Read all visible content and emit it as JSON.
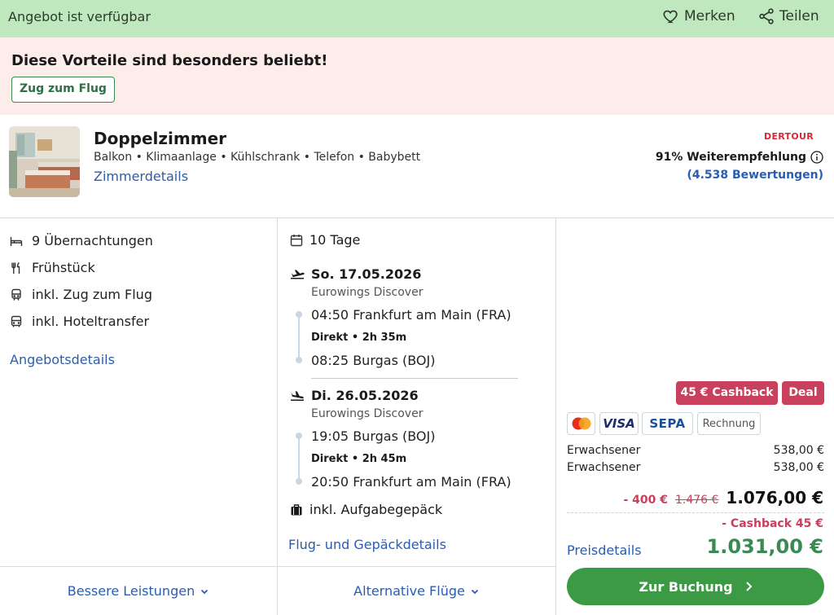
{
  "topbar": {
    "status": "Angebot ist verfügbar",
    "save_label": "Merken",
    "share_label": "Teilen",
    "bg_color": "#bfe8bf",
    "icons": [
      "heart-icon",
      "share-icon"
    ]
  },
  "promo": {
    "title": "Diese Vorteile sind besonders beliebt!",
    "chip": "Zug zum Flug",
    "bg_color": "#fcecea"
  },
  "room": {
    "name": "Doppelzimmer",
    "features": "Balkon • Klimaanlage • Kühlschrank • Telefon • Babybett",
    "details_link": "Zimmerdetails",
    "brand": "DERTOUR",
    "recommendation": "91% Weiterempfehlung",
    "reviews": "(4.538 Bewertungen)"
  },
  "inclusions": {
    "items": [
      {
        "icon": "bed-icon",
        "label": "9 Übernachtungen"
      },
      {
        "icon": "cutlery-icon",
        "label": "Frühstück"
      },
      {
        "icon": "train-icon",
        "label": "inkl. Zug zum Flug"
      },
      {
        "icon": "bus-icon",
        "label": "inkl. Hoteltransfer"
      }
    ],
    "details_link": "Angebotsdetails",
    "more_button": "Bessere Leistungen"
  },
  "flights": {
    "duration": "10 Tage",
    "outbound": {
      "date": "So. 17.05.2026",
      "airline": "Eurowings Discover",
      "dep": "04:50 Frankfurt am Main (FRA)",
      "info": "Direkt • 2h 35m",
      "arr": "08:25 Burgas (BOJ)"
    },
    "inbound": {
      "date": "Di. 26.05.2026",
      "airline": "Eurowings Discover",
      "dep": "19:05 Burgas (BOJ)",
      "info": "Direkt • 2h 45m",
      "arr": "20:50 Frankfurt am Main (FRA)"
    },
    "baggage": "inkl. Aufgabegepäck",
    "details_link": "Flug- und Gepäckdetails",
    "more_button": "Alternative Flüge"
  },
  "pricing": {
    "badges": [
      "45 € Cashback",
      "Deal"
    ],
    "payment_methods": [
      "mastercard",
      "VISA",
      "SEPA",
      "Rechnung"
    ],
    "lines": [
      {
        "label": "Erwachsener",
        "value": "538,00 €"
      },
      {
        "label": "Erwachsener",
        "value": "538,00 €"
      }
    ],
    "discount": "- 400 €",
    "old_price": "1.476 €",
    "subtotal": "1.076,00 €",
    "cashback": "- Cashback 45 €",
    "details_link": "Preisdetails",
    "final_price": "1.031,00 €",
    "cta": "Zur Buchung",
    "accent_green": "#3c9a45",
    "accent_red": "#c8405c",
    "link_blue": "#2a5db0"
  }
}
